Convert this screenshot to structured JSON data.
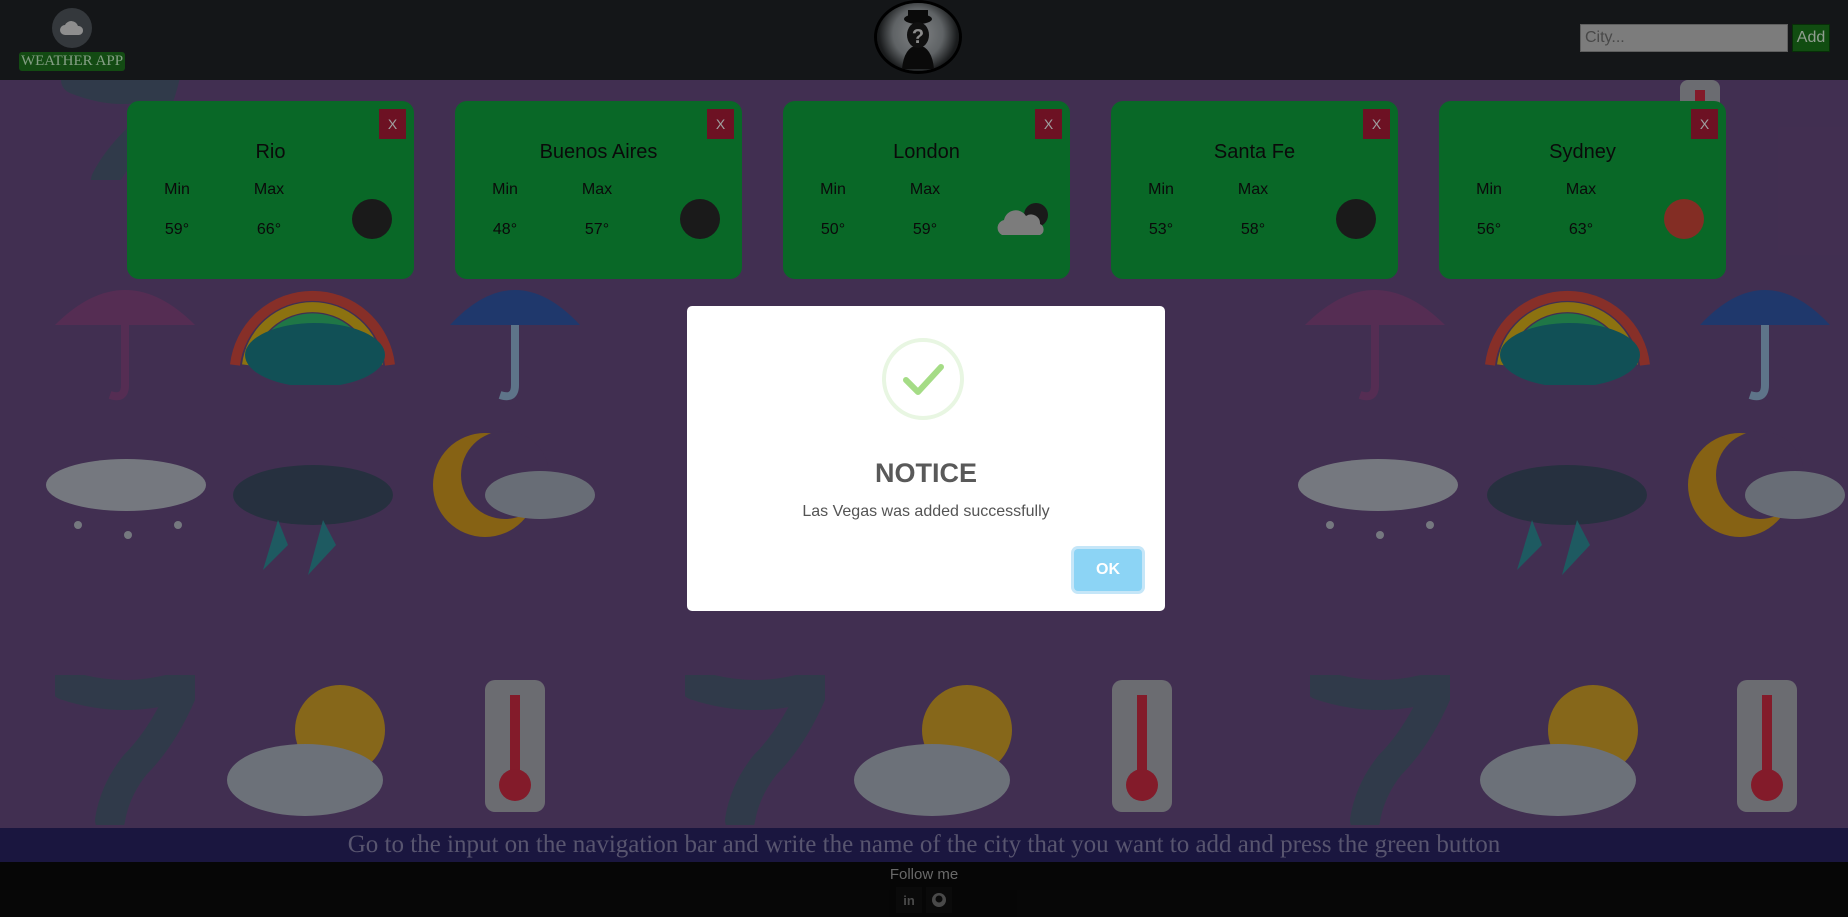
{
  "navbar": {
    "brand_label": "WEATHER APP",
    "brand_icon": "cloud-icon",
    "avatar_icon": "anonymous-user-avatar",
    "search": {
      "placeholder": "City...",
      "value": ""
    },
    "add_label": "Add"
  },
  "cards": [
    {
      "city": "Rio",
      "min_label": "Min",
      "max_label": "Max",
      "min": "59°",
      "max": "66°",
      "close_label": "X",
      "weather_icon": "dark-circle-icon"
    },
    {
      "city": "Buenos Aires",
      "min_label": "Min",
      "max_label": "Max",
      "min": "48°",
      "max": "57°",
      "close_label": "X",
      "weather_icon": "dark-circle-icon"
    },
    {
      "city": "London",
      "min_label": "Min",
      "max_label": "Max",
      "min": "50°",
      "max": "59°",
      "close_label": "X",
      "weather_icon": "cloud-icon"
    },
    {
      "city": "Santa Fe",
      "min_label": "Min",
      "max_label": "Max",
      "min": "53°",
      "max": "58°",
      "close_label": "X",
      "weather_icon": "dark-circle-icon"
    },
    {
      "city": "Sydney",
      "min_label": "Min",
      "max_label": "Max",
      "min": "56°",
      "max": "63°",
      "close_label": "X",
      "weather_icon": "red-circle-icon"
    }
  ],
  "hint": "Go to the input on the navigation bar and write the name of the city that you want to add and press the green button",
  "footer": {
    "follow_label": "Follow me",
    "social_icons": [
      "linkedin-icon",
      "github-icon"
    ]
  },
  "modal": {
    "icon": "success-check-icon",
    "title": "NOTICE",
    "message": "Las Vegas was added successfully",
    "ok_label": "OK"
  },
  "colors": {
    "card": "#0fa83f",
    "close_button": "#b01c39",
    "add_button": "#1c7c1c",
    "background": "#6a4c83",
    "ok_button": "#8cd4f5"
  }
}
